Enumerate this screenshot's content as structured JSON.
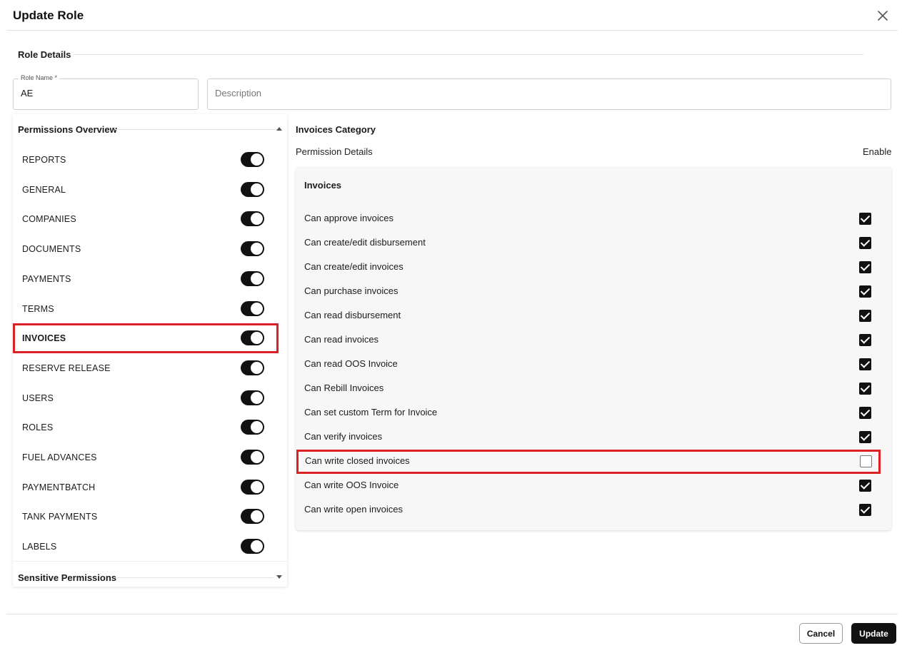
{
  "dialog": {
    "title": "Update Role",
    "close_icon": "close-icon"
  },
  "role_details": {
    "section_title": "Role Details",
    "role_name": {
      "label": "Role Name *",
      "value": "AE"
    },
    "description": {
      "placeholder": "Description",
      "value": ""
    }
  },
  "permissions_overview": {
    "title": "Permissions Overview",
    "items": [
      {
        "label": "REPORTS",
        "enabled": true
      },
      {
        "label": "GENERAL",
        "enabled": true
      },
      {
        "label": "COMPANIES",
        "enabled": true
      },
      {
        "label": "DOCUMENTS",
        "enabled": true
      },
      {
        "label": "PAYMENTS",
        "enabled": true
      },
      {
        "label": "TERMS",
        "enabled": true
      },
      {
        "label": "INVOICES",
        "enabled": true,
        "selected": true
      },
      {
        "label": "RESERVE RELEASE",
        "enabled": true
      },
      {
        "label": "USERS",
        "enabled": true
      },
      {
        "label": "ROLES",
        "enabled": true
      },
      {
        "label": "FUEL ADVANCES",
        "enabled": true
      },
      {
        "label": "PAYMENTBATCH",
        "enabled": true
      },
      {
        "label": "TANK PAYMENTS",
        "enabled": true
      },
      {
        "label": "LABELS",
        "enabled": true
      }
    ],
    "sensitive_title": "Sensitive Permissions"
  },
  "category": {
    "title": "Invoices Category",
    "permission_details_label": "Permission Details",
    "enable_label": "Enable",
    "card_title": "Invoices",
    "permissions": [
      {
        "label": "Can approve invoices",
        "checked": true
      },
      {
        "label": "Can create/edit disbursement",
        "checked": true
      },
      {
        "label": "Can create/edit invoices",
        "checked": true
      },
      {
        "label": "Can purchase invoices",
        "checked": true
      },
      {
        "label": "Can read disbursement",
        "checked": true
      },
      {
        "label": "Can read invoices",
        "checked": true
      },
      {
        "label": "Can read OOS Invoice",
        "checked": true
      },
      {
        "label": "Can Rebill Invoices",
        "checked": true
      },
      {
        "label": "Can set custom Term for Invoice",
        "checked": true
      },
      {
        "label": "Can verify invoices",
        "checked": true
      },
      {
        "label": "Can write closed invoices",
        "checked": false,
        "highlighted": true
      },
      {
        "label": "Can write OOS Invoice",
        "checked": true
      },
      {
        "label": "Can write open invoices",
        "checked": true
      }
    ]
  },
  "footer": {
    "cancel_label": "Cancel",
    "update_label": "Update"
  },
  "colors": {
    "accent": "#111111",
    "highlight": "#dd1f26",
    "card_bg": "#f7f7f7"
  }
}
